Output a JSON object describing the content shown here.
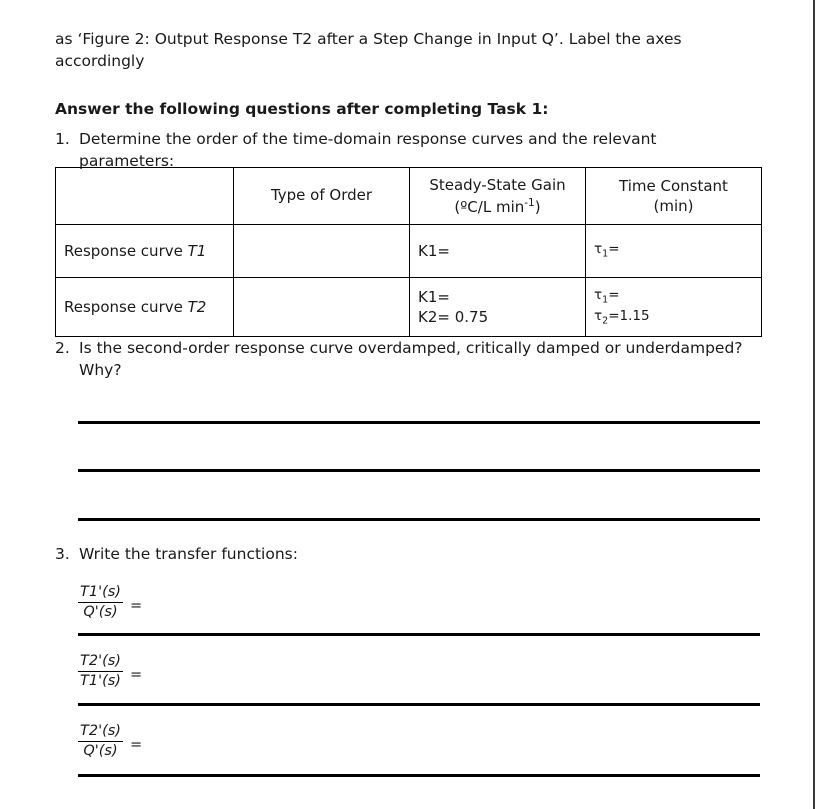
{
  "document": {
    "intro": {
      "line1": "as ‘Figure 2: Output Response T2 after a Step Change in Input Q’. Label the axes",
      "line2": "accordingly"
    },
    "prompt": "Answer the following questions after completing Task 1:",
    "questions": [
      {
        "number": "1.",
        "text_main": "Determine the order of the time-domain response curves and the relevant",
        "text_tail": "parameters:"
      },
      {
        "number": "2.",
        "text_main": "Is the second-order response curve overdamped, critically damped or underdamped?",
        "text_tail": "Why?"
      },
      {
        "number": "3.",
        "text_main": "Write the transfer functions:",
        "text_tail": ""
      }
    ],
    "table": {
      "headers": {
        "corner": "",
        "order": "Type of Order",
        "gain_line1": "Steady-State Gain",
        "gain_line2_pre": "(ºC/L min",
        "gain_line2_sup": "-1",
        "gain_line2_post": ")",
        "time_line1": "Time Constant",
        "time_line2": "(min)"
      },
      "rows": [
        {
          "label_pre": "Response curve ",
          "label_em": "T1",
          "order": "",
          "gain_line1": "K1=",
          "gain_line2": "",
          "tau_line1_sym": "τ",
          "tau_line1_sub": "1",
          "tau_line1_val": "=",
          "tau_line2_sym": "",
          "tau_line2_sub": "",
          "tau_line2_val": ""
        },
        {
          "label_pre": "Response curve ",
          "label_em": "T2",
          "order": "",
          "gain_line1": "K1=",
          "gain_line2": "K2= 0.75",
          "tau_line1_sym": "τ",
          "tau_line1_sub": "1",
          "tau_line1_val": "=",
          "tau_line2_sym": "τ",
          "tau_line2_sub": "2",
          "tau_line2_val": "=1.15"
        }
      ]
    },
    "answer_lines": {
      "count": 3,
      "line1": "",
      "line2": "",
      "line3": ""
    },
    "transfer_functions": [
      {
        "numerator": "T1'(s)",
        "denominator": "Q'(s)",
        "equals": "=",
        "answer": ""
      },
      {
        "numerator": "T2'(s)",
        "denominator": "T1'(s)",
        "equals": "=",
        "answer": ""
      },
      {
        "numerator": "T2'(s)",
        "denominator": "Q'(s)",
        "equals": "=",
        "answer": ""
      }
    ],
    "colors": {
      "ink": "#1a1a1a",
      "rule": "#000000",
      "page_edge": "#3a3a3a"
    }
  }
}
